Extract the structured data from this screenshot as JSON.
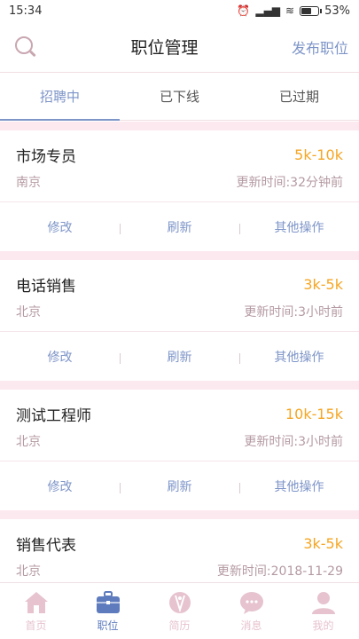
{
  "status_bar": {
    "time": "15:34",
    "battery": "53%"
  },
  "header": {
    "title": "职位管理",
    "action": "发布职位"
  },
  "tabs": [
    {
      "label": "招聘中",
      "active": true
    },
    {
      "label": "已下线",
      "active": false
    },
    {
      "label": "已过期",
      "active": false
    }
  ],
  "jobs": [
    {
      "title": "市场专员",
      "salary": "5k-10k",
      "city": "南京",
      "updated": "更新时间:32分钟前"
    },
    {
      "title": "电话销售",
      "salary": "3k-5k",
      "city": "北京",
      "updated": "更新时间:3小时前"
    },
    {
      "title": "测试工程师",
      "salary": "10k-15k",
      "city": "北京",
      "updated": "更新时间:3小时前"
    },
    {
      "title": "销售代表",
      "salary": "3k-5k",
      "city": "北京",
      "updated": "更新时间:2018-11-29"
    }
  ],
  "card_actions": {
    "edit": "修改",
    "refresh": "刷新",
    "more": "其他操作"
  },
  "tabbar": [
    {
      "label": "首页",
      "icon": "home-icon"
    },
    {
      "label": "职位",
      "icon": "briefcase-icon",
      "active": true
    },
    {
      "label": "简历",
      "icon": "resume-icon"
    },
    {
      "label": "消息",
      "icon": "message-icon"
    },
    {
      "label": "我的",
      "icon": "profile-icon"
    }
  ],
  "colors": {
    "accent": "#7e95c8",
    "salary": "#f5a623",
    "tab_active": "#5d7bbd",
    "tab_inactive": "#e6c3ce",
    "divider": "#fce9ef"
  }
}
